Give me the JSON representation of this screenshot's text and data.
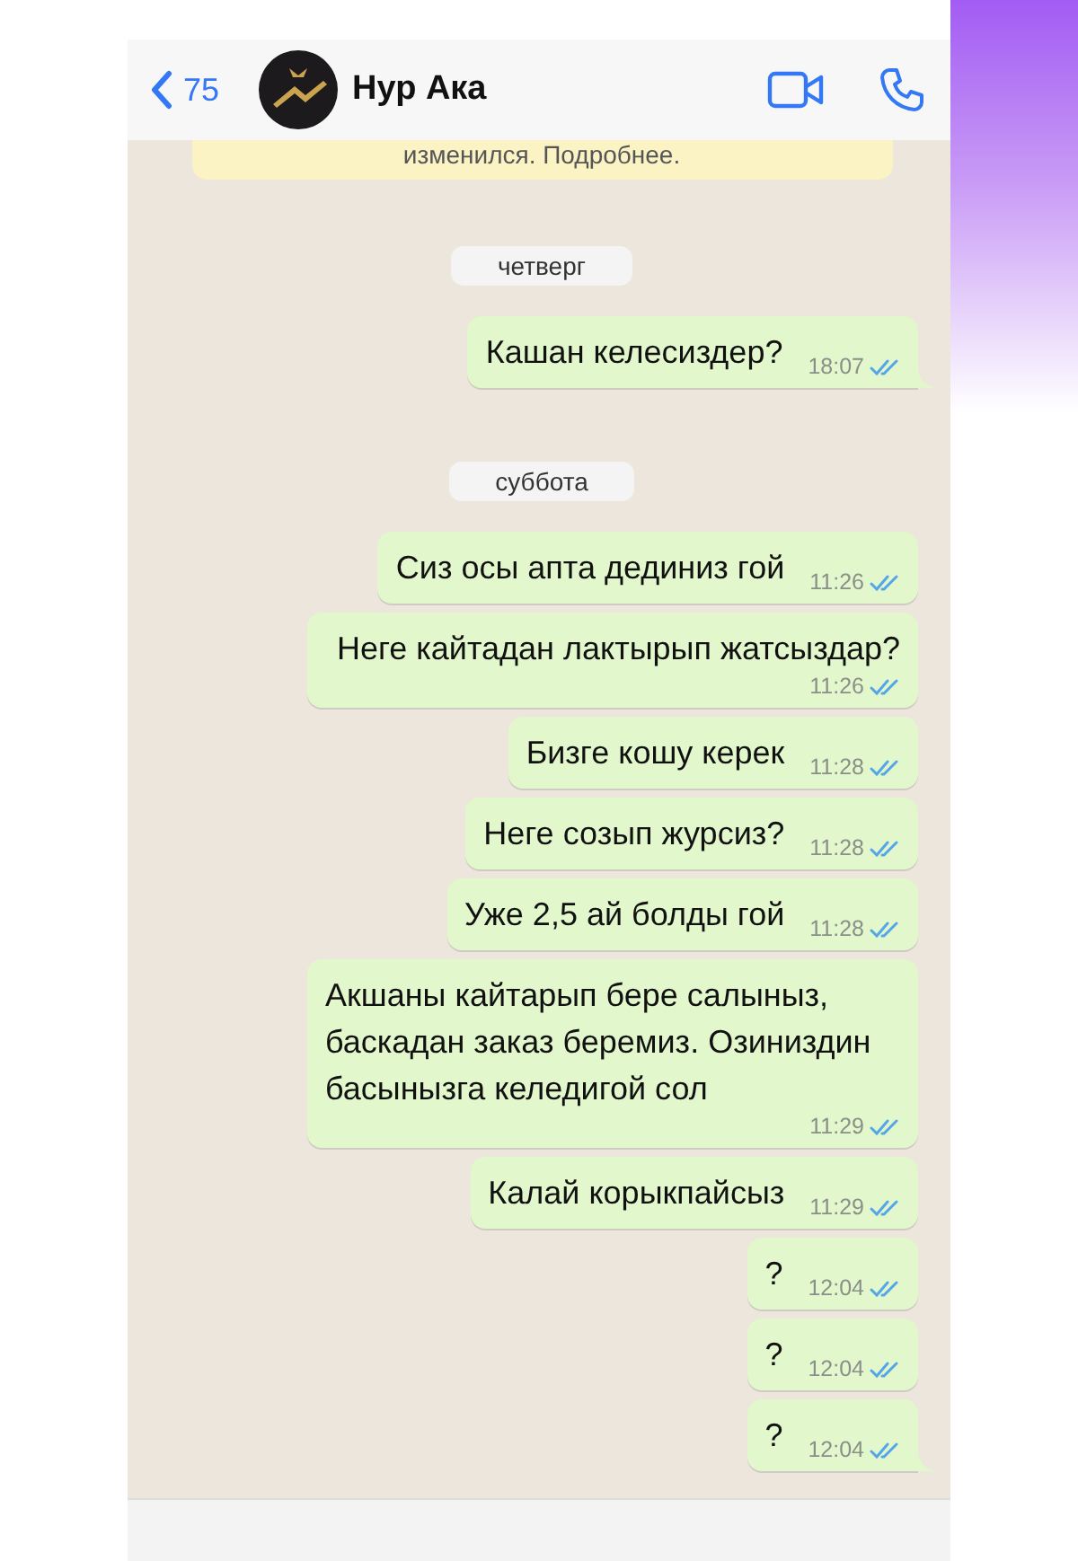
{
  "header": {
    "back_count": "75",
    "contact_name": "Нур Ака"
  },
  "notice": {
    "text": "изменился. Подробнее."
  },
  "items": [
    {
      "kind": "date",
      "text": "четверг"
    },
    {
      "kind": "message",
      "text": "Кашан келесиздер?",
      "time": "18:07",
      "read": true,
      "tail": true
    },
    {
      "kind": "date",
      "text": "суббота"
    },
    {
      "kind": "message",
      "text": "Сиз осы апта дединиз гой",
      "time": "11:26",
      "read": true,
      "tail": false
    },
    {
      "kind": "message",
      "text": "Неге кайтадан лактырып жатсыздар?",
      "time": "11:26",
      "read": true,
      "tail": false
    },
    {
      "kind": "message",
      "text": "Бизге кошу керек",
      "time": "11:28",
      "read": true,
      "tail": false
    },
    {
      "kind": "message",
      "text": "Неге созып журсиз?",
      "time": "11:28",
      "read": true,
      "tail": false
    },
    {
      "kind": "message",
      "text": "Уже 2,5 ай болды гой",
      "time": "11:28",
      "read": true,
      "tail": false
    },
    {
      "kind": "message",
      "text": "Акшаны кайтарып бере салыныз, баскадан заказ беремиз. Озиниздин басынызга келедигой сол",
      "time": "11:29",
      "read": true,
      "tail": false
    },
    {
      "kind": "message",
      "text": "Калай корыкпайсыз",
      "time": "11:29",
      "read": true,
      "tail": false
    },
    {
      "kind": "message",
      "text": "?",
      "time": "12:04",
      "read": true,
      "tail": false
    },
    {
      "kind": "message",
      "text": "?",
      "time": "12:04",
      "read": true,
      "tail": false
    },
    {
      "kind": "message",
      "text": "?",
      "time": "12:04",
      "read": true,
      "tail": true
    }
  ]
}
